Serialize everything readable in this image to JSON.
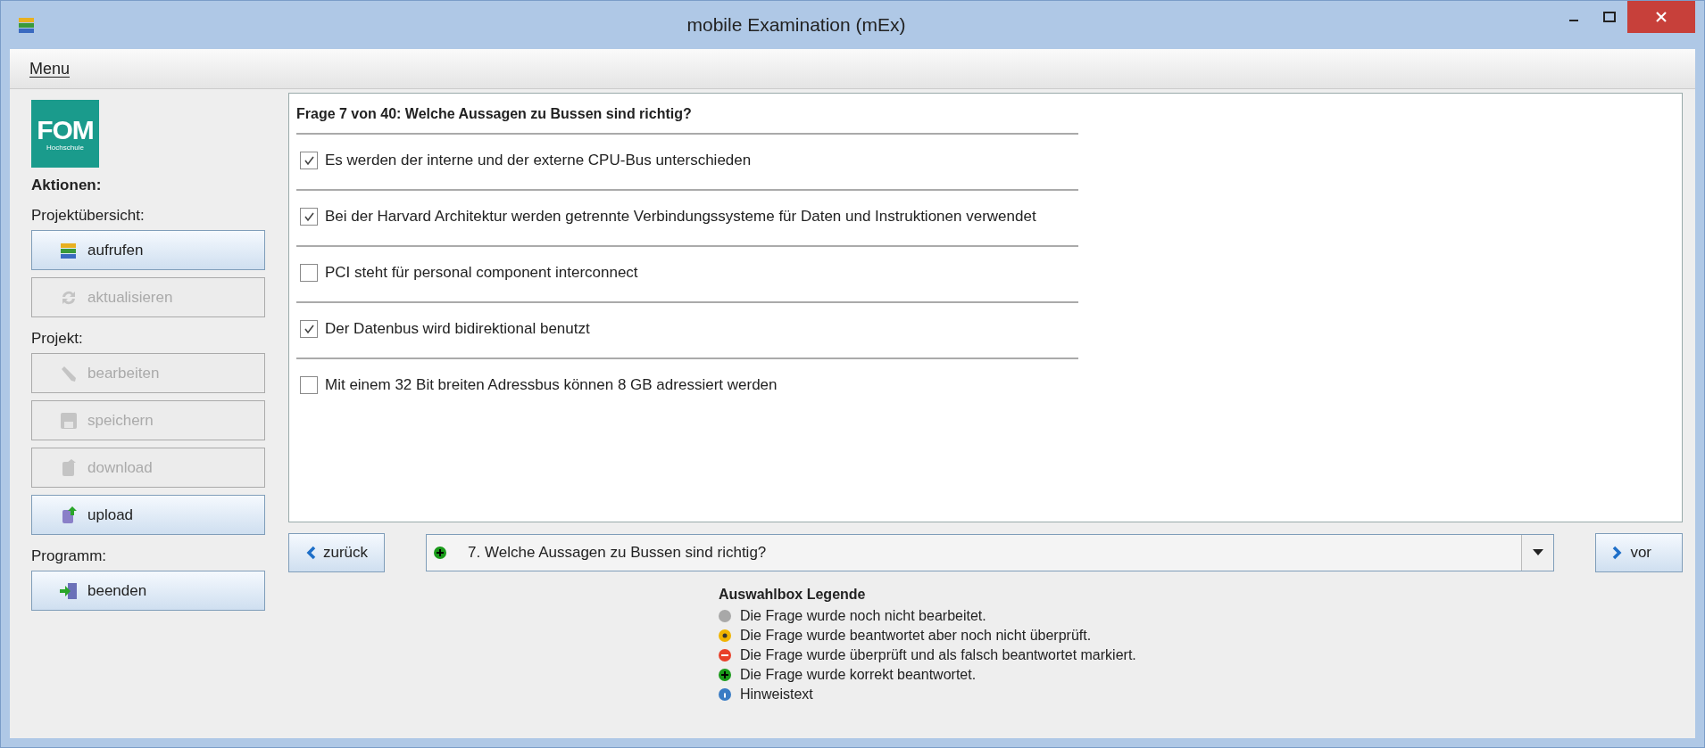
{
  "window": {
    "title": "mobile Examination (mEx)"
  },
  "menu": [
    "Menu"
  ],
  "sidebar": {
    "logo": {
      "main": "FOM",
      "sub": "Hochschule"
    },
    "heading": "Aktionen:",
    "sections": [
      {
        "label": "Projektübersicht:",
        "buttons": [
          {
            "label": "aufrufen",
            "kind": "books",
            "disabled": false
          },
          {
            "label": "aktualisieren",
            "kind": "refresh",
            "disabled": true
          }
        ]
      },
      {
        "label": "Projekt:",
        "buttons": [
          {
            "label": "bearbeiten",
            "kind": "pencil",
            "disabled": true
          },
          {
            "label": "speichern",
            "kind": "disk",
            "disabled": true
          },
          {
            "label": "download",
            "kind": "download",
            "disabled": true
          },
          {
            "label": "upload",
            "kind": "upload",
            "disabled": false
          }
        ]
      },
      {
        "label": "Programm:",
        "buttons": [
          {
            "label": "beenden",
            "kind": "exit",
            "disabled": false
          }
        ]
      }
    ]
  },
  "question": {
    "title": "Frage 7 von 40: Welche Aussagen zu Bussen sind richtig?",
    "answers": [
      {
        "label": "Es werden der interne und der externe CPU-Bus unterschieden",
        "checked": true
      },
      {
        "label": "Bei der Harvard Architektur werden getrennte Verbindungssysteme für Daten und Instruktionen verwendet",
        "checked": true
      },
      {
        "label": "PCI steht für personal component interconnect",
        "checked": false
      },
      {
        "label": "Der Datenbus wird bidirektional benutzt",
        "checked": true
      },
      {
        "label": "Mit einem 32 Bit breiten Adressbus können 8 GB adressiert werden",
        "checked": false
      }
    ]
  },
  "navigation": {
    "back": "zurück",
    "next": "vor",
    "select": {
      "value": "7. Welche Aussagen zu Bussen sind richtig?",
      "kind": "correct",
      "color": "#1a9a1a"
    }
  },
  "legend": {
    "title": "Auswahlbox Legende",
    "items": [
      {
        "label": "Die Frage wurde noch nicht bearbeitet.",
        "kind": "pending",
        "color": "#a8a8a8"
      },
      {
        "label": "Die Frage wurde beantwortet aber noch nicht überprüft.",
        "kind": "answered",
        "color": "#f0b400"
      },
      {
        "label": "Die Frage wurde überprüft und als falsch beantwortet markiert.",
        "kind": "wrong",
        "color": "#e8402a"
      },
      {
        "label": "Die Frage wurde korrekt beantwortet.",
        "kind": "correct",
        "color": "#1a9a1a"
      },
      {
        "label": "Hinweistext",
        "kind": "info",
        "color": "#3a7cc4"
      }
    ]
  }
}
